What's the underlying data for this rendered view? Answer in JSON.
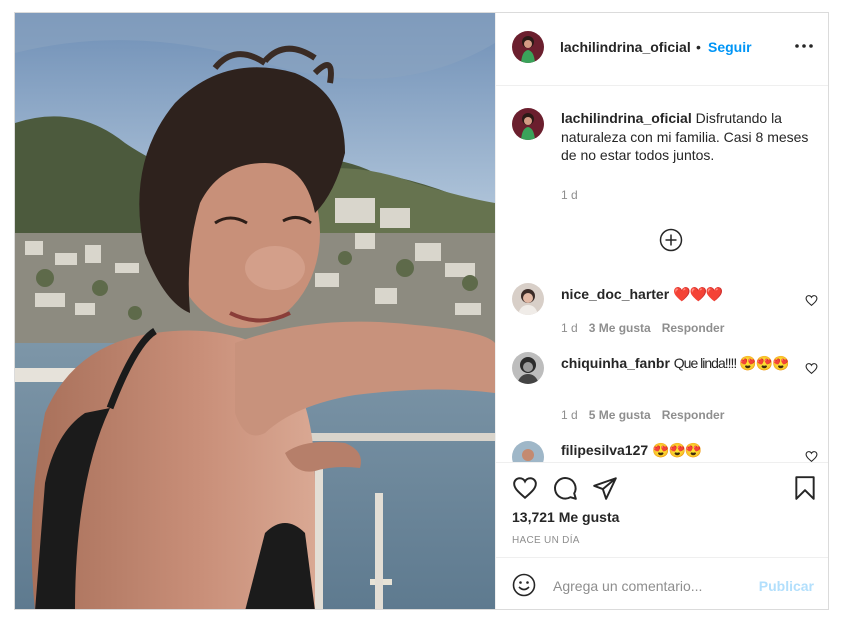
{
  "post": {
    "username": "lachilindrina_oficial",
    "dot": "•",
    "follow_label": "Seguir",
    "caption": "Disfrutando la naturaleza con mi familia. Casi 8 meses de no estar todos juntos.",
    "caption_time": "1 d",
    "likes": "13,721 Me gusta",
    "time_ago": "HACE UN DÍA"
  },
  "comments": [
    {
      "user": "nice_doc_harter",
      "text": "❤️❤️❤️",
      "time": "1 d",
      "likes": "3 Me gusta",
      "reply": "Responder"
    },
    {
      "user": "chiquinha_fanbr",
      "text": "Que linda!!!! 😍😍😍",
      "time": "1 d",
      "likes": "5 Me gusta",
      "reply": "Responder"
    },
    {
      "user": "filipesilva127",
      "text": "😍😍😍"
    }
  ],
  "add_comment": {
    "placeholder": "Agrega un comentario...",
    "publish_label": "Publicar"
  },
  "colors": {
    "accent": "#0095f6",
    "publish_disabled": "#b2dffc",
    "muted": "#8e8e8e"
  },
  "icons": [
    "more-options-icon",
    "add-circle-icon",
    "heart-icon",
    "comment-icon",
    "share-icon",
    "bookmark-icon",
    "emoji-icon"
  ]
}
